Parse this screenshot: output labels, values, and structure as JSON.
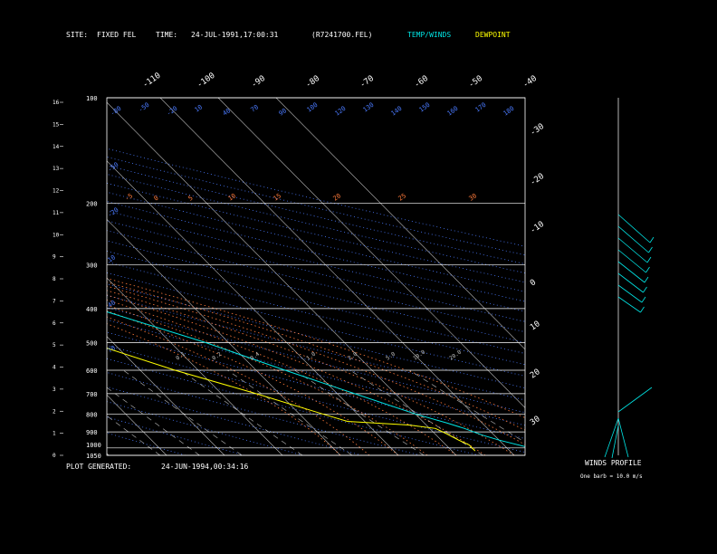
{
  "header": {
    "site_label": "SITE:",
    "site_value": "FIXED FEL",
    "time_label": "TIME:",
    "time_value": "24-JUL-1991,17:00:31",
    "file": "(R7241700.FEL)",
    "legend_temp": "TEMP/WINDS",
    "legend_dew": "DEWPOINT"
  },
  "footer": {
    "generated_label": "PLOT GENERATED:",
    "generated_value": "24-JUN-1994,00:34:16"
  },
  "wind_panel": {
    "title": "WINDS PROFILE",
    "note": "One barb = 10.0 m/s"
  },
  "colors": {
    "temp": "#00e5e5",
    "dewpoint": "#ffff00",
    "grid": "#ffffff",
    "isotherm": "#bbbbbb",
    "dry_adiabat": "#4a7aff",
    "moist_adiabat": "#ff7a3a",
    "mixing_ratio": "#bbbbbb"
  },
  "chart_data": {
    "type": "line",
    "pressure_levels": [
      1050,
      1000,
      900,
      800,
      700,
      600,
      500,
      400,
      300,
      200,
      100
    ],
    "pressure_labels": [
      "1050",
      "1000",
      "900",
      "800",
      "700",
      "600",
      "500",
      "400",
      "300",
      "200",
      "100"
    ],
    "height_ticks": [
      "0",
      "1",
      "2",
      "3",
      "4",
      "5",
      "6",
      "7",
      "8",
      "9",
      "10",
      "11",
      "12",
      "13",
      "14",
      "15",
      "16"
    ],
    "temp_ticks": [
      "-110",
      "-100",
      "-90",
      "-80",
      "-70",
      "-60",
      "-50",
      "-40",
      "-30",
      "-20",
      "-10",
      "0",
      "10",
      "20",
      "30"
    ],
    "dry_adiabat_labels": [
      "-80",
      "-50",
      "-20",
      "10",
      "40",
      "70",
      "90",
      "100",
      "120",
      "130",
      "140",
      "150",
      "160",
      "170",
      "180",
      "190"
    ],
    "moist_adiabat_labels": [
      "-5",
      "0",
      "5",
      "10",
      "15",
      "20",
      "25",
      "30",
      "35"
    ],
    "mixing_ratio_labels": [
      "0.1",
      "0.2",
      "0.4",
      "1.0",
      "2.0",
      "5.0",
      "10.0",
      "20.0"
    ],
    "temperature": [
      {
        "p": 1040,
        "t": 28
      },
      {
        "p": 1000,
        "t": 24
      },
      {
        "p": 950,
        "t": 20
      },
      {
        "p": 920,
        "t": 18
      },
      {
        "p": 880,
        "t": 16
      },
      {
        "p": 850,
        "t": 14
      },
      {
        "p": 800,
        "t": 10
      },
      {
        "p": 700,
        "t": 3
      },
      {
        "p": 600,
        "t": -5
      },
      {
        "p": 500,
        "t": -14
      },
      {
        "p": 400,
        "t": -27
      },
      {
        "p": 350,
        "t": -35
      },
      {
        "p": 300,
        "t": -44
      },
      {
        "p": 250,
        "t": -54
      },
      {
        "p": 210,
        "t": -60
      }
    ],
    "dewpoint": [
      {
        "p": 1020,
        "t": 14
      },
      {
        "p": 980,
        "t": 14
      },
      {
        "p": 950,
        "t": 13
      },
      {
        "p": 910,
        "t": 12
      },
      {
        "p": 880,
        "t": 11
      },
      {
        "p": 860,
        "t": 7
      },
      {
        "p": 840,
        "t": -3
      },
      {
        "p": 800,
        "t": -6
      },
      {
        "p": 700,
        "t": -14
      },
      {
        "p": 600,
        "t": -24
      },
      {
        "p": 500,
        "t": -34
      },
      {
        "p": 420,
        "t": -43
      },
      {
        "p": 370,
        "t": -49
      },
      {
        "p": 355,
        "t": -56
      },
      {
        "p": 340,
        "t": -56
      },
      {
        "p": 320,
        "t": -51
      },
      {
        "p": 305,
        "t": -54
      },
      {
        "p": 295,
        "t": -50
      },
      {
        "p": 290,
        "t": -57
      },
      {
        "p": 280,
        "t": -60
      },
      {
        "p": 250,
        "t": -65
      },
      {
        "p": 230,
        "t": -70
      },
      {
        "p": 210,
        "t": -73
      }
    ]
  }
}
